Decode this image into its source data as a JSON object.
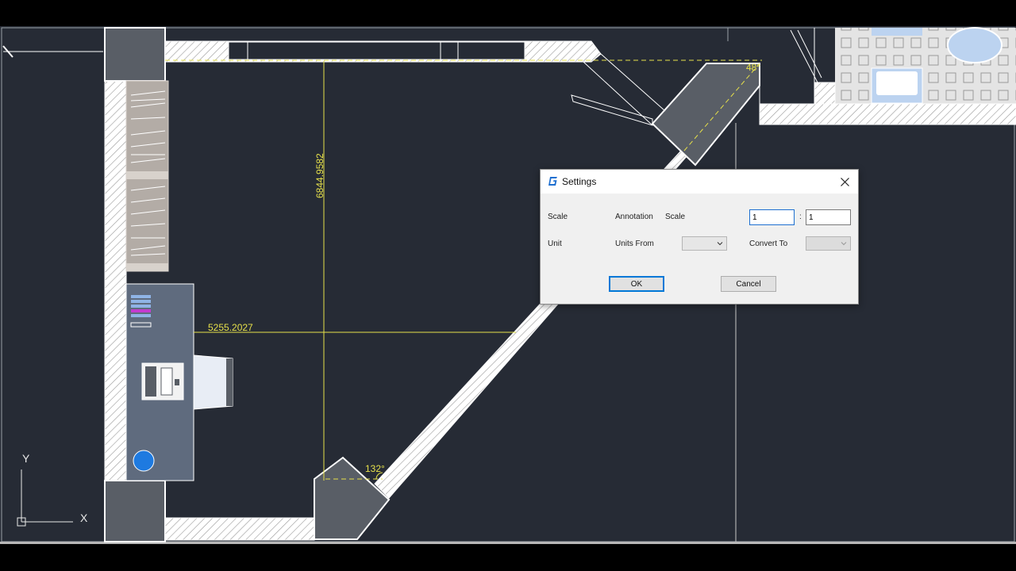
{
  "drawing": {
    "dimensions": {
      "vertical": "6844.9582",
      "horizontal": "5255.2027",
      "angle_bottom": "132°",
      "angle_top": "48°"
    },
    "ucs": {
      "y_label": "Y",
      "x_label": "X"
    },
    "colors": {
      "background": "#262b35",
      "wall_fill": "#ffffff",
      "dimension": "#e6e04a",
      "door_panel": "#595e66"
    }
  },
  "dialog": {
    "title": "Settings",
    "scale_label": "Scale",
    "annotation_label": "Annotation",
    "annotation_scale_label": "Scale",
    "scale_value_left": "1",
    "scale_separator": ":",
    "scale_value_right": "1",
    "unit_label": "Unit",
    "units_from_label": "Units From",
    "units_from_value": "",
    "convert_to_label": "Convert To",
    "convert_to_value": "",
    "ok_label": "OK",
    "cancel_label": "Cancel"
  },
  "icons": {
    "logo": "gstarcad-logo-icon",
    "close": "close-icon",
    "dropdown": "chevron-down-icon"
  }
}
